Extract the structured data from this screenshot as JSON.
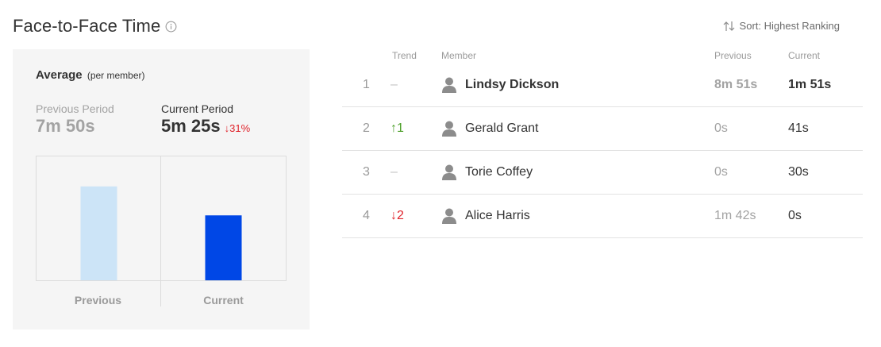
{
  "header": {
    "title": "Face-to-Face Time",
    "sort_label": "Sort: Highest Ranking"
  },
  "average_panel": {
    "heading": "Average",
    "subheading": "(per member)",
    "previous_label": "Previous Period",
    "previous_value": "7m 50s",
    "current_label": "Current Period",
    "current_value": "5m 25s",
    "change": "↓31%",
    "chart_categories": [
      "Previous",
      "Current"
    ]
  },
  "chart_data": {
    "type": "bar",
    "categories": [
      "Previous",
      "Current"
    ],
    "values": [
      470,
      325
    ],
    "value_unit": "seconds",
    "colors": [
      "#cce4f7",
      "#0047e6"
    ],
    "title": "",
    "xlabel": "",
    "ylabel": "",
    "ylim": [
      0,
      620
    ],
    "grid": false,
    "legend": "none"
  },
  "table": {
    "columns": {
      "trend": "Trend",
      "member": "Member",
      "previous": "Previous",
      "current": "Current"
    },
    "rows": [
      {
        "rank": "1",
        "trend": "–",
        "member": "Lindsy Dickson",
        "previous": "8m 51s",
        "current": "1m 51s"
      },
      {
        "rank": "2",
        "trend": "↑1",
        "member": "Gerald Grant",
        "previous": "0s",
        "current": "41s"
      },
      {
        "rank": "3",
        "trend": "–",
        "member": "Torie Coffey",
        "previous": "0s",
        "current": "30s"
      },
      {
        "rank": "4",
        "trend": "↓2",
        "member": "Alice Harris",
        "previous": "1m 42s",
        "current": "0s"
      }
    ]
  },
  "icons": {
    "info": "info-icon",
    "sort": "sort-arrows-icon",
    "avatar": "user-avatar-icon"
  },
  "colors": {
    "positive": "#4ea02b",
    "negative": "#e0242c",
    "bar_previous": "#cce4f7",
    "bar_current": "#0047e6",
    "panel_bg": "#f5f5f5"
  }
}
